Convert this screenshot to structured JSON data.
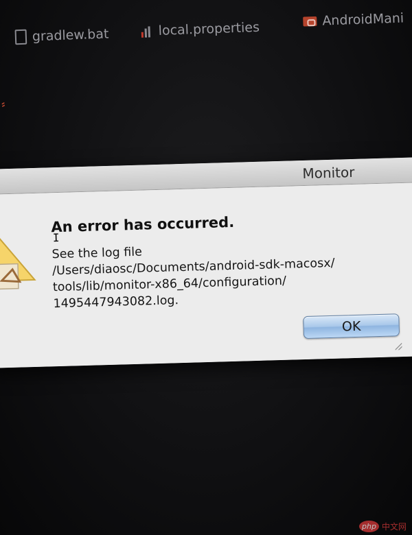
{
  "editor": {
    "tabs": [
      {
        "label": "gradlew.bat",
        "icon": "file-icon"
      },
      {
        "label": "local.properties",
        "icon": "properties-icon"
      },
      {
        "label": "AndroidMani",
        "icon": "android-manifest-icon"
      }
    ]
  },
  "dialog": {
    "title": "Monitor",
    "headline": "An error has occurred.",
    "message_lines": [
      "See the log file",
      "/Users/diaosc/Documents/android-sdk-macosx/",
      "tools/lib/monitor-x86_64/configuration/",
      "1495447943082.log."
    ],
    "ok_label": "OK",
    "icon": "warning-icon"
  },
  "colors": {
    "background": "#0b0b0c",
    "dialog_body": "#ececec",
    "ok_button": "#a9c8ea",
    "watermark": "#d93a3a"
  },
  "watermark": {
    "logo": "php",
    "text": "中文网"
  }
}
